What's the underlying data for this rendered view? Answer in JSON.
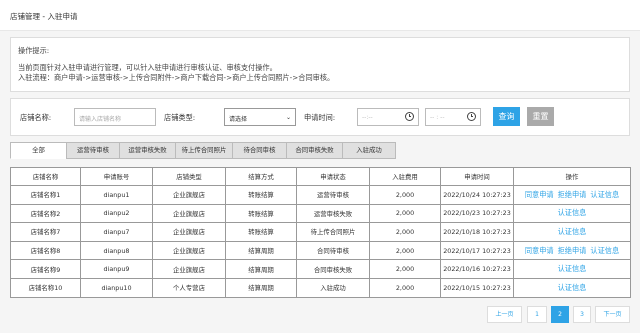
{
  "breadcrumb": "店铺管理 - 入驻申请",
  "tips": {
    "title": "操作提示:",
    "lines": [
      "当前页面针对入驻申请进行管理，可以针入驻申请进行审核认证、审核支付操作。",
      "入驻流程：商户申请->运营审核->上传合同附件->商户下载合同->商户上传合同照片->合同审核。"
    ]
  },
  "search": {
    "shop_name_label": "店铺名称:",
    "shop_name_placeholder": "请输入店铺名称",
    "shop_type_label": "店铺类型:",
    "shop_type_value": "请选择",
    "apply_time_label": "申请时间:",
    "date_from_placeholder": "--:--",
    "date_to_placeholder": "-- : --",
    "query_label": "查询",
    "reset_label": "重置"
  },
  "tabs": [
    "全部",
    "运营待审核",
    "运营审核失败",
    "待上传合同照片",
    "待合同审核",
    "合同审核失败",
    "入驻成功"
  ],
  "table": {
    "headers": [
      "店铺名称",
      "申请账号",
      "店铺类型",
      "结算方式",
      "申请状态",
      "入驻费用",
      "申请时间",
      "操作"
    ],
    "rows": [
      {
        "name": "店铺名称1",
        "account": "dianpu1",
        "type": "企业旗舰店",
        "settle": "转账结算",
        "status": "运营待审核",
        "fee": "2,000",
        "time": "2022/10/24 10:27:23",
        "ops": [
          "同意申请",
          "拒绝申请",
          "认证信息"
        ]
      },
      {
        "name": "店铺名称2",
        "account": "dianpu2",
        "type": "企业旗舰店",
        "settle": "转账结算",
        "status": "运营审核失败",
        "fee": "2,000",
        "time": "2022/10/23 10:27:23",
        "ops": [
          "认证信息"
        ]
      },
      {
        "name": "店铺名称7",
        "account": "dianpu7",
        "type": "企业旗舰店",
        "settle": "转账结算",
        "status": "待上传合同照片",
        "fee": "2,000",
        "time": "2022/10/18 10:27:23",
        "ops": [
          "认证信息"
        ]
      },
      {
        "name": "店铺名称8",
        "account": "dianpu8",
        "type": "企业旗舰店",
        "settle": "结算周期",
        "status": "合同待审核",
        "fee": "2,000",
        "time": "2022/10/17 10:27:23",
        "ops": [
          "同意申请",
          "拒绝申请",
          "认证信息"
        ]
      },
      {
        "name": "店铺名称9",
        "account": "dianpu9",
        "type": "企业旗舰店",
        "settle": "结算周期",
        "status": "合同审核失败",
        "fee": "2,000",
        "time": "2022/10/16 10:27:23",
        "ops": [
          "认证信息"
        ]
      },
      {
        "name": "店铺名称10",
        "account": "dianpu10",
        "type": "个人专营店",
        "settle": "结算周期",
        "status": "入驻成功",
        "fee": "2,000",
        "time": "2022/10/15 10:27:23",
        "ops": [
          "认证信息"
        ]
      }
    ]
  },
  "pager": {
    "prev": "上一页",
    "pages": [
      "1",
      "2",
      "3"
    ],
    "current": "2",
    "next": "下一页"
  }
}
